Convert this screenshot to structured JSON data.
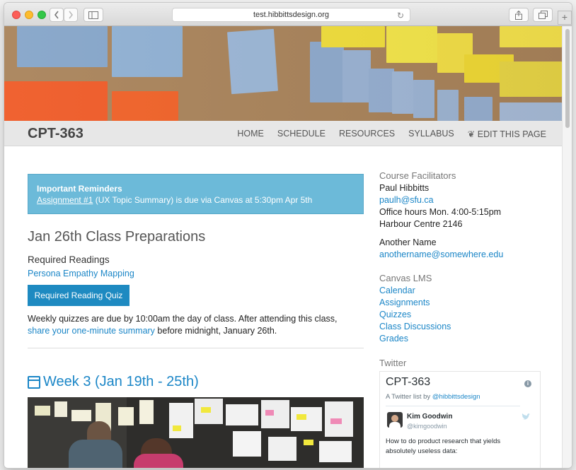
{
  "browser": {
    "url": "test.hibbittsdesign.org",
    "reload_icon": "reload-icon",
    "share_icon": "share-icon",
    "tabs_icon": "tabs-icon",
    "new_tab_label": "+"
  },
  "site": {
    "brand": "CPT-363",
    "nav": [
      {
        "label": "HOME"
      },
      {
        "label": "SCHEDULE"
      },
      {
        "label": "RESOURCES"
      },
      {
        "label": "SYLLABUS"
      },
      {
        "label": "EDIT THIS PAGE",
        "icon": "edit-icon"
      }
    ]
  },
  "reminder": {
    "title": "Important Reminders",
    "link": "Assignment #1",
    "rest": " (UX Topic Summary) is due via Canvas at 5:30pm Apr 5th"
  },
  "prep": {
    "heading": "Jan 26th Class Preparations",
    "required_label": "Required Readings",
    "reading_link": "Persona Empathy Mapping",
    "quiz_button": "Required Reading Quiz",
    "para_before": "Weekly quizzes are due by 10:00am the day of class. After attending this class, ",
    "para_link": "share your one-minute summary",
    "para_after": " before midnight, January 26th."
  },
  "week": {
    "heading": "Week 3 (Jan 19th - 25th)"
  },
  "sidebar": {
    "facilitators_heading": "Course Facilitators",
    "person1": {
      "name": "Paul Hibbitts",
      "email": "paulh@sfu.ca",
      "hours": "Office hours Mon. 4:00-5:15pm",
      "location": "Harbour Centre 2146"
    },
    "person2": {
      "name": "Another Name",
      "email": "anothername@somewhere.edu"
    },
    "canvas_heading": "Canvas LMS",
    "canvas_links": [
      "Calendar",
      "Assignments",
      "Quizzes",
      "Class Discussions",
      "Grades"
    ],
    "twitter_heading": "Twitter",
    "twitter": {
      "list_title": "CPT-363",
      "byline_prefix": "A Twitter list by ",
      "byline_handle": "@hibbittsdesign",
      "tweet_name": "Kim Goodwin",
      "tweet_handle": "@kimgoodwin",
      "tweet_text": "How to do product research that yields absolutely useless data:"
    }
  },
  "colors": {
    "accent": "#1b86c7",
    "alert_bg": "#6cbad9",
    "button_bg": "#1e8ac1",
    "navbar_bg": "#e7e7e7"
  }
}
